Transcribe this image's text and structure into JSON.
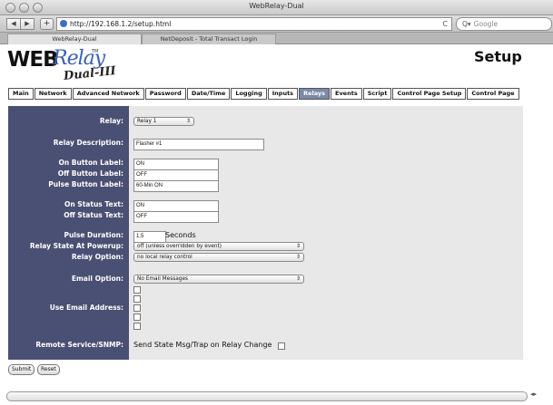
{
  "window": {
    "title": "WebRelay-Dual"
  },
  "toolbar": {
    "back": "◀",
    "forward": "▶",
    "add": "+",
    "url": "http://192.168.1.2/setup.html",
    "refresh": "C",
    "search_placeholder": "Google"
  },
  "browser_tabs": [
    "WebRelay-Dual",
    "NetDeposit - Total Transact Login"
  ],
  "logo": {
    "web": "WEB",
    "relay": "Relay",
    "tm": "TM",
    "dual": "Dual-III"
  },
  "page": {
    "title": "Setup"
  },
  "nav": [
    "Main",
    "Network",
    "Advanced Network",
    "Password",
    "Date/Time",
    "Logging",
    "Inputs",
    "Relays",
    "Events",
    "Script",
    "Control Page Setup",
    "Control Page"
  ],
  "nav_active": "Relays",
  "form": {
    "relay_label": "Relay:",
    "relay_value": "Relay 1",
    "desc_label": "Relay Description:",
    "desc_value": "Flasher #1",
    "on_btn_label": "On Button Label:",
    "on_btn_value": "ON",
    "off_btn_label": "Off Button Label:",
    "off_btn_value": "OFF",
    "pulse_btn_label": "Pulse Button Label:",
    "pulse_btn_value": "60-Min ON",
    "on_status_label": "On Status Text:",
    "on_status_value": "ON",
    "off_status_label": "Off Status Text:",
    "off_status_value": "OFF",
    "pulse_dur_label": "Pulse Duration:",
    "pulse_dur_value": "1.5",
    "pulse_dur_units": "Seconds",
    "powerup_label": "Relay State At Powerup:",
    "powerup_value": "off (unless overridden by event)",
    "option_label": "Relay Option:",
    "option_value": "no local relay control",
    "email_opt_label": "Email Option:",
    "email_opt_value": "No Email Messages",
    "use_email_label": "Use Email Address:",
    "snmp_label": "Remote Service/SNMP:",
    "snmp_text": "Send State Msg/Trap on Relay Change"
  },
  "buttons": {
    "submit": "Submit",
    "reset": "Reset"
  }
}
